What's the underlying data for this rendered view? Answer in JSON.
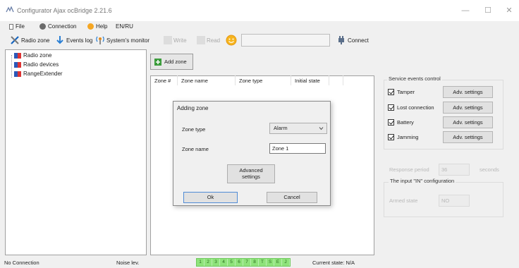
{
  "window": {
    "title": "Configurator Ajax ocBridge 2.21.6",
    "minimize": "—",
    "maximize": "☐",
    "close": "✕"
  },
  "menu": {
    "file": "File",
    "connection": "Connection",
    "help": "Help",
    "language": "EN/RU"
  },
  "toolbar": {
    "radio_zone": "Radio zone",
    "events_log": "Events log",
    "systems_monitor": "System's monitor",
    "write": "Write",
    "read": "Read",
    "connect": "Connect"
  },
  "tree": {
    "items": [
      "Radio zone",
      "Radio devices",
      "RangeExtender"
    ]
  },
  "zones": {
    "add_button": "Add zone",
    "columns": [
      "Zone #",
      "Zone name",
      "Zone type",
      "Initial state"
    ]
  },
  "service_events": {
    "title": "Service events control",
    "rows": [
      {
        "label": "Tamper",
        "checked": true,
        "button": "Adv. settings"
      },
      {
        "label": "Lost connection",
        "checked": true,
        "button": "Adv. settings"
      },
      {
        "label": "Battery",
        "checked": true,
        "button": "Adv. settings"
      },
      {
        "label": "Jamming",
        "checked": true,
        "button": "Adv. settings"
      }
    ],
    "response_period_label": "Response period",
    "response_period_value": "36",
    "response_period_unit": "seconds",
    "in_config_title": "The input \"IN\" configuration",
    "armed_state_label": "Armed state",
    "armed_state_value": "NO"
  },
  "dialog": {
    "title": "Adding zone",
    "zone_type_label": "Zone type",
    "zone_type_value": "Alarm",
    "zone_name_label": "Zone name",
    "zone_name_value": "Zone 1",
    "advanced_line1": "Advanced",
    "advanced_line2": "settings",
    "ok": "Ok",
    "cancel": "Cancel"
  },
  "status": {
    "connection": "No Connection",
    "noise": "Noise lev.",
    "indicators": [
      "1",
      "2",
      "3",
      "4",
      "5",
      "6",
      "7",
      "8",
      "T",
      "S",
      "E",
      "J"
    ],
    "current_state": "Current state:  N/A"
  },
  "colors": {
    "indicator_green": "#8fe37b",
    "titlebar": "#ffffff",
    "background": "#f0f0f0"
  }
}
